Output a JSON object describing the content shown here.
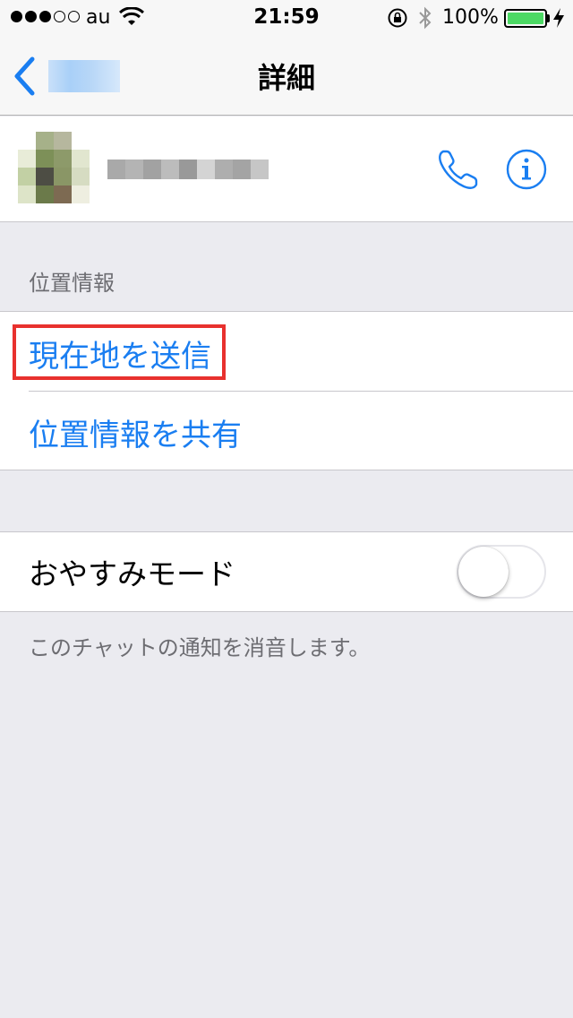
{
  "status_bar": {
    "carrier": "au",
    "time": "21:59",
    "battery_percent": "100%",
    "battery_level": 1.0,
    "signal_bars_filled": 3,
    "signal_bars_total": 5
  },
  "nav": {
    "title": "詳細",
    "back_icon": "chevron-left-icon"
  },
  "contact": {
    "phone_icon": "phone-icon",
    "info_icon": "info-icon"
  },
  "location_section": {
    "header": "位置情報",
    "send_current_location": "現在地を送信",
    "share_location": "位置情報を共有"
  },
  "dnd_section": {
    "label": "おやすみモード",
    "enabled": false,
    "footer": "このチャットの通知を消音します。"
  },
  "colors": {
    "accent": "#1a7ef1",
    "highlight": "#e8312e",
    "battery": "#4cd964",
    "background": "#ebebf0"
  }
}
